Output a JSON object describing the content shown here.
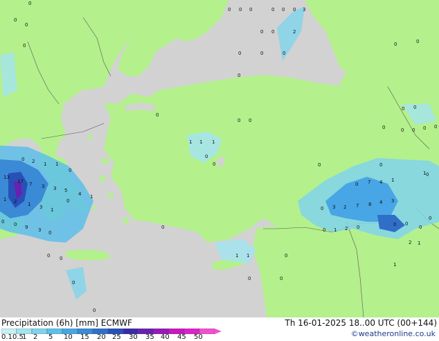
{
  "footer": {
    "title": "Precipitation (6h) [mm] ECMWF",
    "valid": "Th 16-01-2025 18..00 UTC (00+144)",
    "credit": "©weatheronline.co.uk"
  },
  "legend": {
    "labels": [
      "0.1",
      "0.5",
      "1",
      "2",
      "5",
      "10",
      "15",
      "20",
      "25",
      "30",
      "35",
      "40",
      "45",
      "50"
    ],
    "colors": [
      "#c8f0f4",
      "#a4e4ef",
      "#80d4ec",
      "#5ec0ea",
      "#48a6e6",
      "#3a8ad6",
      "#2f6fc8",
      "#2850b8",
      "#3a2aa8",
      "#6a20b0",
      "#9a18b8",
      "#c818c0",
      "#e020c8",
      "#f050d0"
    ]
  },
  "map": {
    "land_color": "#b4f08c",
    "sea_color": "#d2d2d2",
    "precip_values": [
      "0",
      "0",
      "0",
      "0",
      "0",
      "0",
      "0",
      "3",
      "0",
      "0",
      "2",
      "0",
      "0",
      "0",
      "0",
      "0",
      "0",
      "0",
      "0",
      "0",
      "0",
      "0",
      "1",
      "1",
      "1",
      "0",
      "0",
      "0",
      "2",
      "1",
      "1",
      "0",
      "13",
      "17",
      "7",
      "3",
      "3",
      "5",
      "4",
      "1",
      "2",
      "1",
      "3",
      "1",
      "9",
      "3",
      "0",
      "0",
      "1",
      "0",
      "0",
      "0",
      "0",
      "0",
      "0",
      "0",
      "1",
      "1",
      "0",
      "0",
      "0",
      "0",
      "0",
      "1",
      "0",
      "7",
      "4",
      "1",
      "0",
      "3",
      "2",
      "7",
      "8",
      "4",
      "3",
      "0",
      "1",
      "2",
      "0",
      "0",
      "0",
      "0",
      "0",
      "1",
      "0",
      "2",
      "0",
      "0",
      "0",
      "0",
      "0",
      "0",
      "0",
      "0",
      "1",
      "0"
    ]
  }
}
